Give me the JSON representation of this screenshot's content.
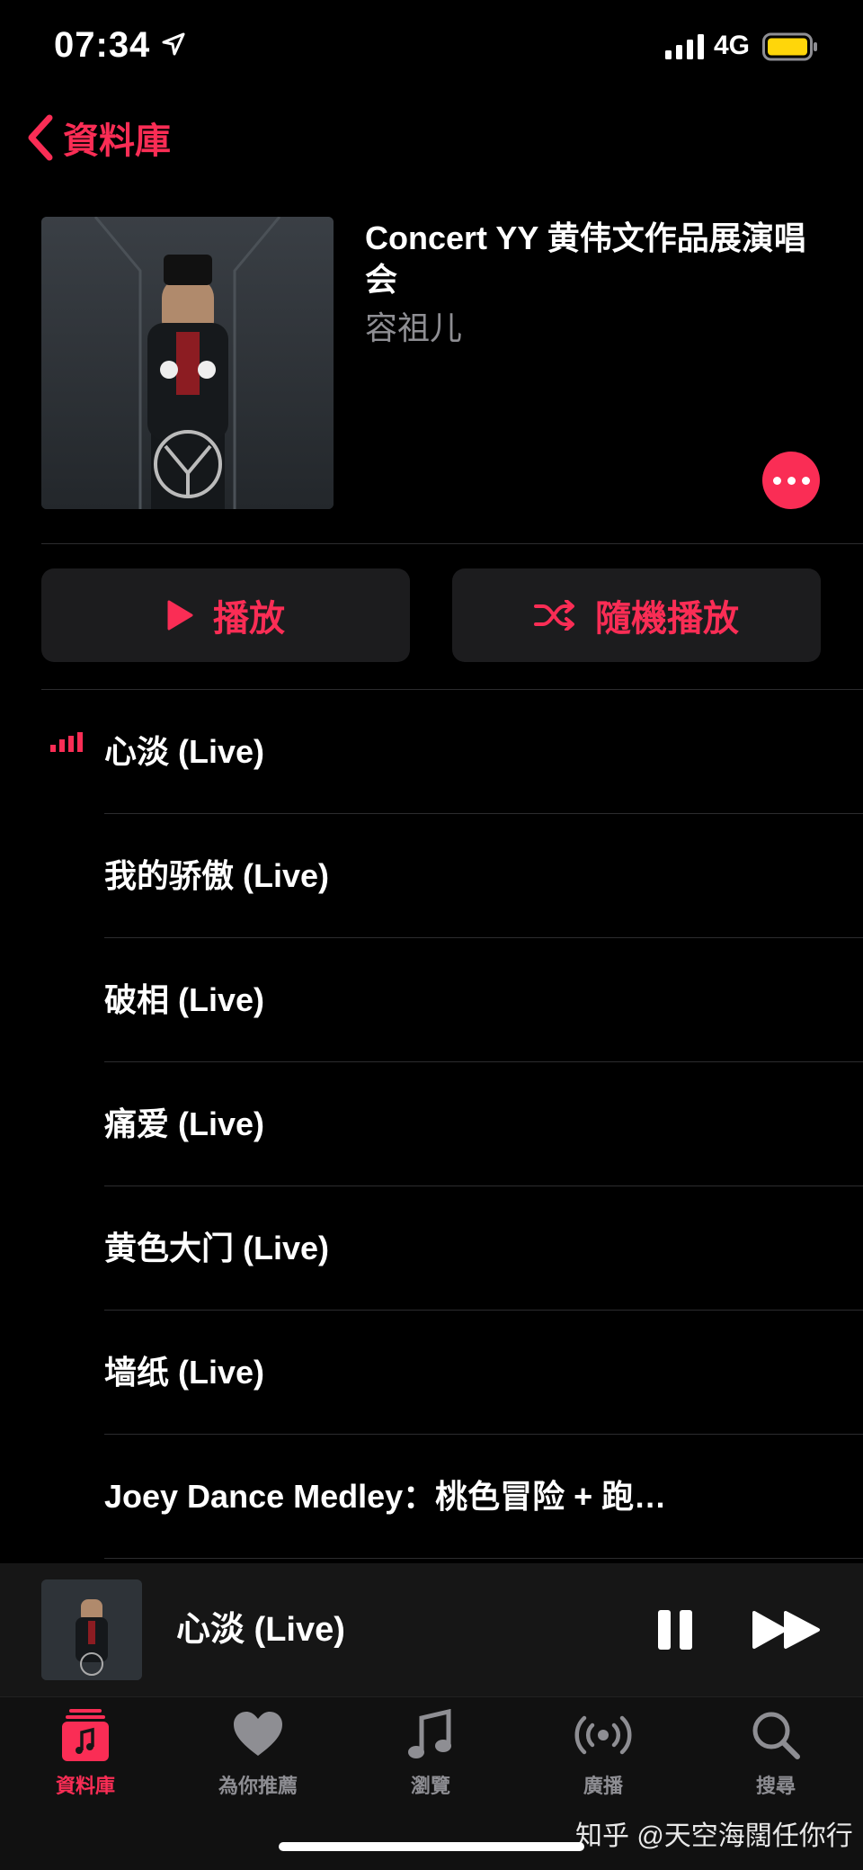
{
  "status_bar": {
    "time": "07:34",
    "network": "4G",
    "battery_color": "#ffd60a"
  },
  "nav": {
    "back_label": "資料庫"
  },
  "album": {
    "title": "Concert YY 黄伟文作品展演唱会",
    "artist": "容祖儿",
    "more_icon": "ellipsis-icon"
  },
  "actions": {
    "play_label": "播放",
    "shuffle_label": "隨機播放"
  },
  "tracks": [
    {
      "title": "心淡 (Live)",
      "now_playing": true
    },
    {
      "title": "我的骄傲 (Live)"
    },
    {
      "title": "破相 (Live)"
    },
    {
      "title": "痛爱 (Live)"
    },
    {
      "title": "黄色大门 (Live)"
    },
    {
      "title": "墙纸 (Live)"
    },
    {
      "title": "Joey Dance Medley：桃色冒险 + 跑…"
    }
  ],
  "mini_player": {
    "title": "心淡 (Live)",
    "state": "playing"
  },
  "tabs": [
    {
      "label": "資料庫",
      "icon": "library-icon",
      "active": true
    },
    {
      "label": "為你推薦",
      "icon": "heart-icon"
    },
    {
      "label": "瀏覽",
      "icon": "music-note-icon"
    },
    {
      "label": "廣播",
      "icon": "radio-icon"
    },
    {
      "label": "搜尋",
      "icon": "search-icon"
    }
  ],
  "watermark": "知乎 @天空海闊任你行",
  "colors": {
    "accent": "#fa2d55",
    "background": "#000000",
    "secondary_text": "#8e8e93"
  }
}
